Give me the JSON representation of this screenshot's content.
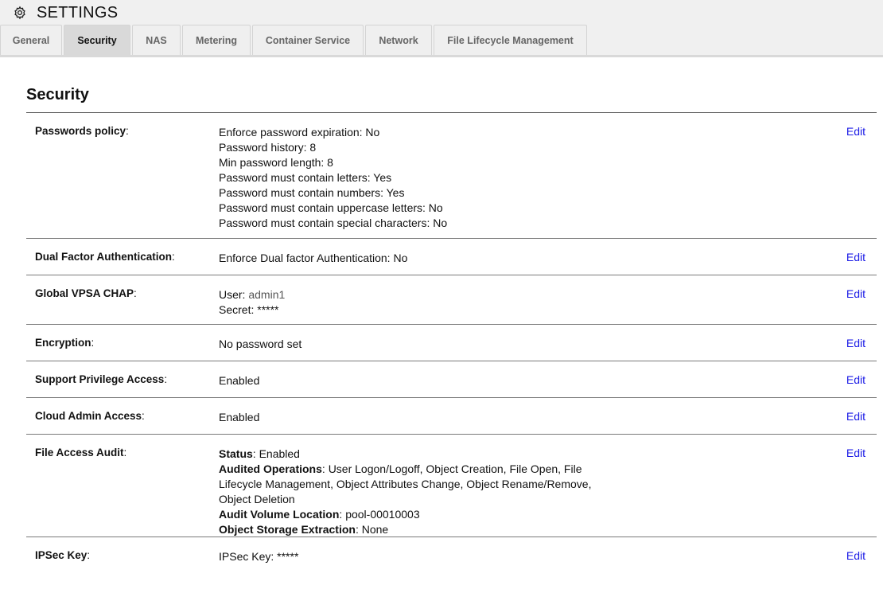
{
  "header": {
    "title": "SETTINGS",
    "icon": "gear-icon"
  },
  "tabs": [
    {
      "label": "General",
      "active": false
    },
    {
      "label": "Security",
      "active": true
    },
    {
      "label": "NAS",
      "active": false
    },
    {
      "label": "Metering",
      "active": false
    },
    {
      "label": "Container Service",
      "active": false
    },
    {
      "label": "Network",
      "active": false
    },
    {
      "label": "File Lifecycle Management",
      "active": false
    }
  ],
  "section": {
    "title": "Security",
    "edit_label": "Edit"
  },
  "rows": {
    "passwords": {
      "label": "Passwords policy",
      "lines": [
        "Enforce password expiration: No",
        "Password history: 8",
        "Min password length: 8",
        "Password must contain letters: Yes",
        "Password must contain numbers: Yes",
        "Password must contain uppercase letters: No",
        "Password must contain special characters: No"
      ]
    },
    "dual_factor": {
      "label": "Dual Factor Authentication",
      "value": "Enforce Dual factor Authentication: No"
    },
    "chap": {
      "label": "Global VPSA CHAP",
      "user_label": "User:",
      "user_value": "admin1",
      "secret": "Secret: *****"
    },
    "encryption": {
      "label": "Encryption",
      "value": "No password set"
    },
    "support": {
      "label": "Support Privilege Access",
      "value": "Enabled"
    },
    "cloud_admin": {
      "label": "Cloud Admin Access",
      "value": "Enabled"
    },
    "audit": {
      "label": "File Access Audit",
      "status_key": "Status",
      "status_val": "Enabled",
      "ops_key": "Audited Operations",
      "ops_val": "User Logon/Logoff, Object Creation, File Open, File Lifecycle Management, Object Attributes Change, Object Rename/Remove, Object Deletion",
      "location_key": "Audit Volume Location",
      "location_val": "pool-00010003",
      "extraction_key": "Object Storage Extraction",
      "extraction_val": "None"
    },
    "ipsec": {
      "label": "IPSec Key",
      "value": "IPSec Key: *****"
    }
  }
}
